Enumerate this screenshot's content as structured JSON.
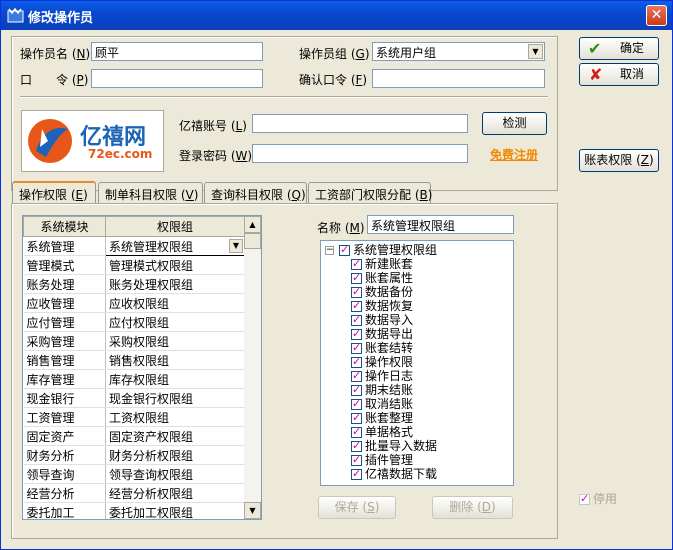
{
  "window": {
    "title": "修改操作员"
  },
  "form": {
    "operator_name_label": "操作员名",
    "operator_name_key": "N",
    "operator_name_value": "顾平",
    "operator_group_label": "操作员组",
    "operator_group_key": "G",
    "operator_group_value": "系统用户组",
    "password_label": "口　　令",
    "password_key": "P",
    "password_value": "",
    "confirm_label": "确认口令",
    "confirm_key": "F",
    "confirm_value": ""
  },
  "buttons": {
    "ok": "确定",
    "cancel": "取消",
    "account_rights": "账表权限",
    "account_rights_key": "Z",
    "detect": "检测",
    "save": "保存",
    "save_key": "S",
    "delete": "删除",
    "delete_key": "D"
  },
  "yixi": {
    "logo_text": "亿禧网",
    "logo_url": "72ec.com",
    "account_label": "亿禧账号",
    "account_key": "L",
    "account_value": "",
    "password_label": "登录密码",
    "password_key": "W",
    "password_value": "",
    "register_link": "免费注册"
  },
  "tabs": [
    {
      "label": "操作权限",
      "key": "E"
    },
    {
      "label": "制单科目权限",
      "key": "V"
    },
    {
      "label": "查询科目权限",
      "key": "Q"
    },
    {
      "label": "工资部门权限分配",
      "key": "B"
    }
  ],
  "grid": {
    "headers": [
      "系统模块",
      "权限组"
    ],
    "rows": [
      [
        "系统管理",
        "系统管理权限组"
      ],
      [
        "管理模式",
        "管理模式权限组"
      ],
      [
        "账务处理",
        "账务处理权限组"
      ],
      [
        "应收管理",
        "应收权限组"
      ],
      [
        "应付管理",
        "应付权限组"
      ],
      [
        "采购管理",
        "采购权限组"
      ],
      [
        "销售管理",
        "销售权限组"
      ],
      [
        "库存管理",
        "库存权限组"
      ],
      [
        "现金银行",
        "现金银行权限组"
      ],
      [
        "工资管理",
        "工资权限组"
      ],
      [
        "固定资产",
        "固定资产权限组"
      ],
      [
        "财务分析",
        "财务分析权限组"
      ],
      [
        "领导查询",
        "领导查询权限组"
      ],
      [
        "经营分析",
        "经营分析权限组"
      ],
      [
        "委托加工",
        "委托加工权限组"
      ]
    ]
  },
  "name_field": {
    "label": "名称",
    "key": "M",
    "value": "系统管理权限组"
  },
  "tree": {
    "root": "系统管理权限组",
    "items": [
      "新建账套",
      "账套属性",
      "数据备份",
      "数据恢复",
      "数据导入",
      "数据导出",
      "账套结转",
      "操作权限",
      "操作日志",
      "期末结账",
      "取消结账",
      "账套整理",
      "单据格式",
      "批量导入数据",
      "插件管理",
      "亿禧数据下载"
    ]
  },
  "disable_label": "停用"
}
